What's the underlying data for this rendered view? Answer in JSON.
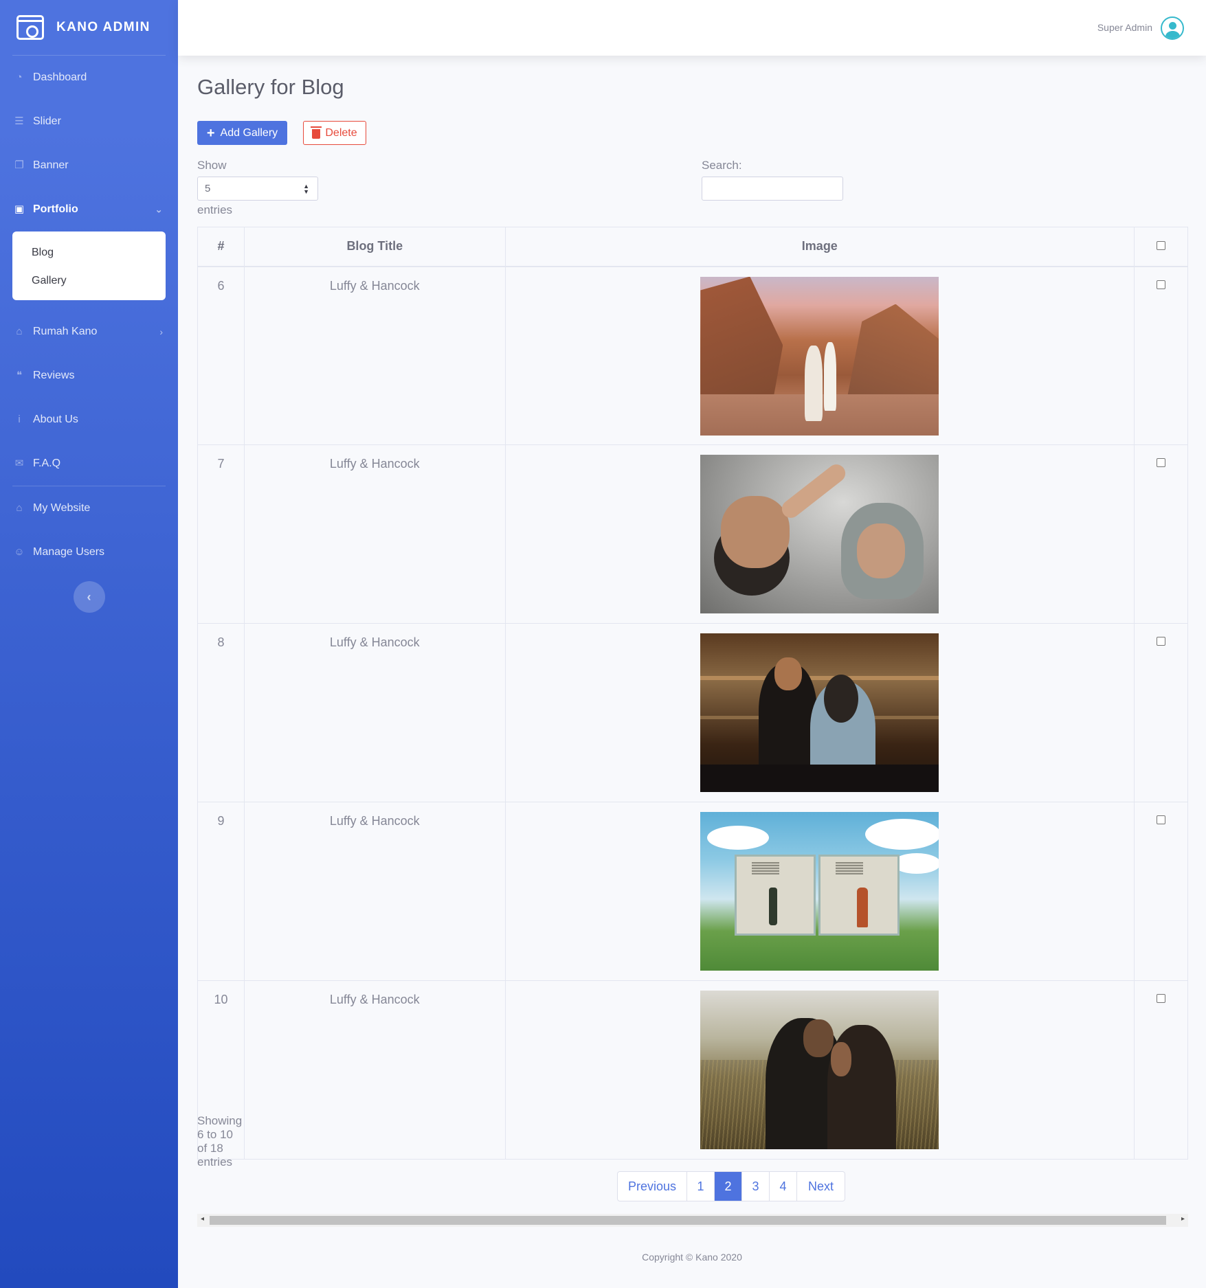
{
  "brand": {
    "name": "KANO ADMIN"
  },
  "sidebar": {
    "items": [
      {
        "label": "Dashboard"
      },
      {
        "label": "Slider"
      },
      {
        "label": "Banner"
      },
      {
        "label": "Portfolio"
      },
      {
        "label": "Rumah Kano"
      },
      {
        "label": "Reviews"
      },
      {
        "label": "About Us"
      },
      {
        "label": "F.A.Q"
      },
      {
        "label": "My Website"
      },
      {
        "label": "Manage Users"
      }
    ],
    "portfolio_submenu": [
      {
        "label": "Blog"
      },
      {
        "label": "Gallery"
      }
    ]
  },
  "topbar": {
    "user_name": "Super Admin"
  },
  "page": {
    "title": "Gallery for Blog",
    "add_button": "Add Gallery",
    "delete_button": "Delete",
    "show_label": "Show",
    "entries_label": "entries",
    "page_length": "5",
    "search_label": "Search:"
  },
  "table": {
    "columns": [
      "#",
      "Blog Title",
      "Image"
    ],
    "rows": [
      {
        "num": "6",
        "title": "Luffy & Hancock"
      },
      {
        "num": "7",
        "title": "Luffy & Hancock"
      },
      {
        "num": "8",
        "title": "Luffy & Hancock"
      },
      {
        "num": "9",
        "title": "Luffy & Hancock"
      },
      {
        "num": "10",
        "title": "Luffy & Hancock"
      }
    ]
  },
  "pagination": {
    "info": "Showing 6 to 10 of 18 entries",
    "previous": "Previous",
    "pages": [
      "1",
      "2",
      "3",
      "4"
    ],
    "current": "2",
    "next": "Next"
  },
  "footer": {
    "copyright": "Copyright © Kano 2020"
  },
  "colors": {
    "primary": "#4e73df",
    "danger": "#e74a3b",
    "sidebar_end": "#224abe"
  }
}
